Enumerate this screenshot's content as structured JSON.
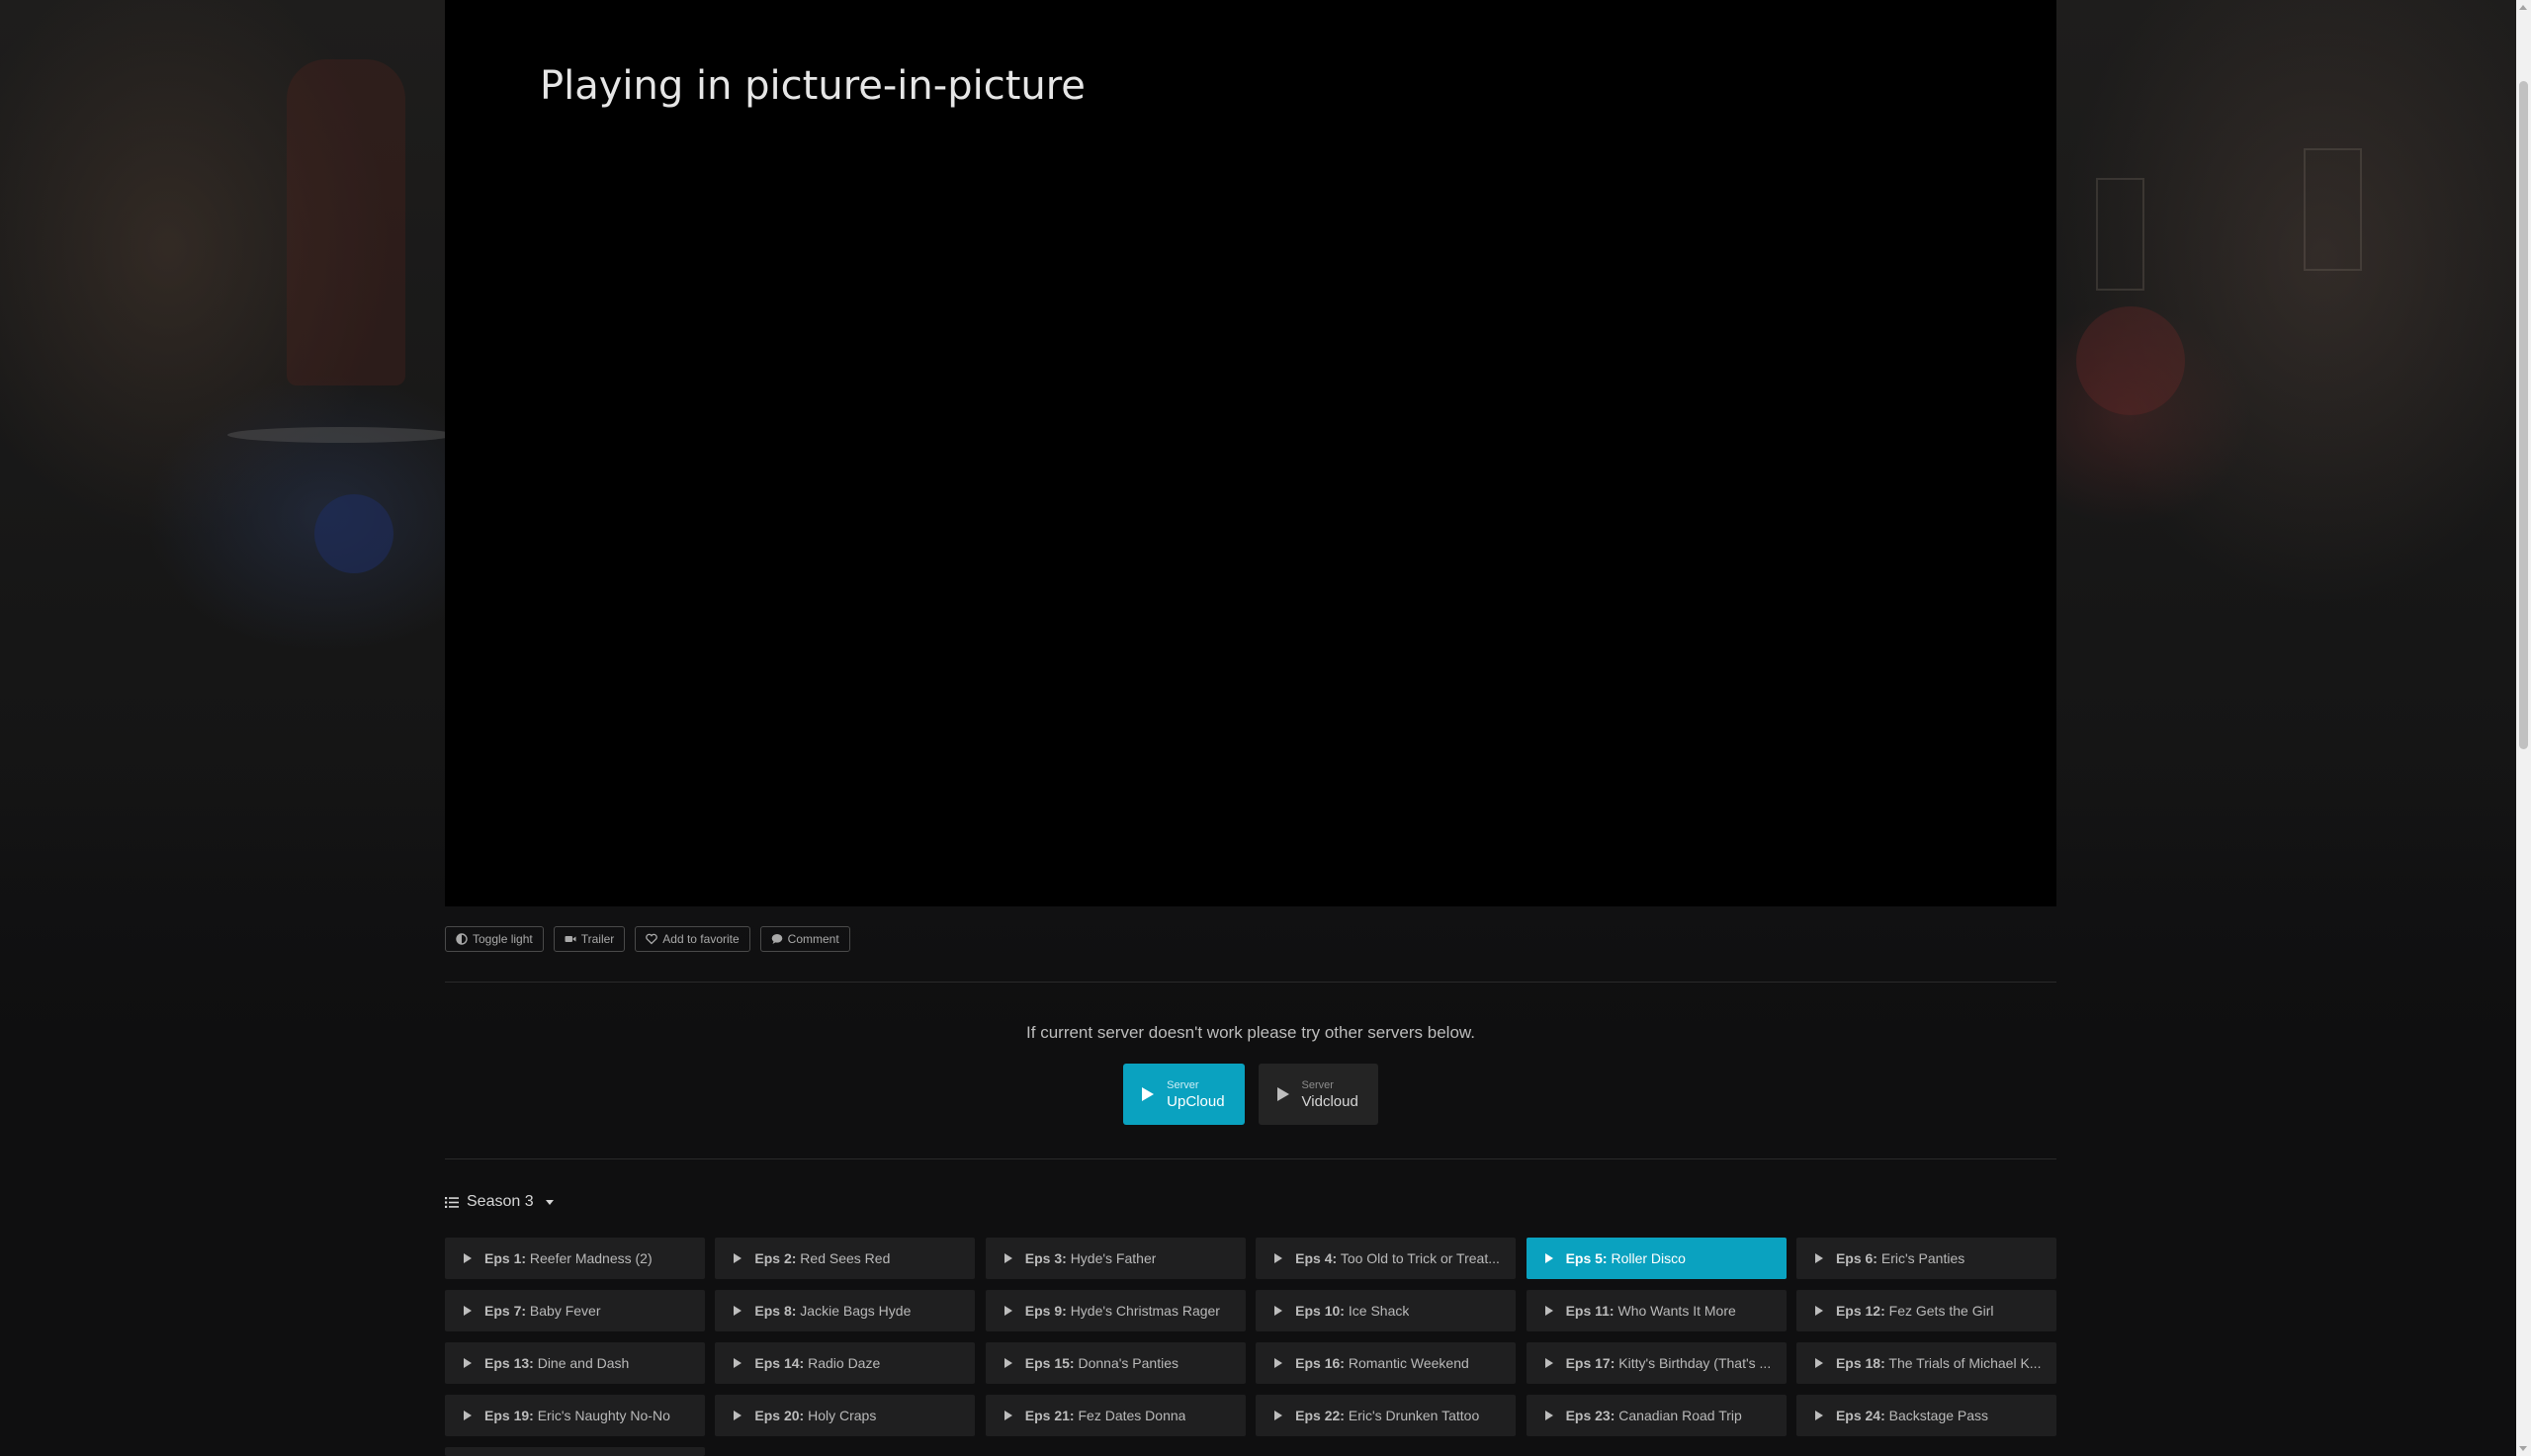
{
  "player": {
    "pip_message": "Playing in picture-in-picture"
  },
  "toolbar": {
    "toggle_light": "Toggle light",
    "trailer": "Trailer",
    "add_favorite": "Add to favorite",
    "comment": "Comment"
  },
  "servers": {
    "note": "If current server doesn't work please try other servers below.",
    "items": [
      {
        "small": "Server",
        "name": "UpCloud",
        "active": true
      },
      {
        "small": "Server",
        "name": "Vidcloud",
        "active": false
      }
    ]
  },
  "season": {
    "label": "Season 3"
  },
  "episodes": [
    {
      "num": "Eps 1:",
      "title": "Reefer Madness (2)"
    },
    {
      "num": "Eps 2:",
      "title": "Red Sees Red"
    },
    {
      "num": "Eps 3:",
      "title": "Hyde's Father"
    },
    {
      "num": "Eps 4:",
      "title": "Too Old to Trick or Treat..."
    },
    {
      "num": "Eps 5:",
      "title": "Roller Disco",
      "active": true
    },
    {
      "num": "Eps 6:",
      "title": "Eric's Panties"
    },
    {
      "num": "Eps 7:",
      "title": "Baby Fever"
    },
    {
      "num": "Eps 8:",
      "title": "Jackie Bags Hyde"
    },
    {
      "num": "Eps 9:",
      "title": "Hyde's Christmas Rager"
    },
    {
      "num": "Eps 10:",
      "title": "Ice Shack"
    },
    {
      "num": "Eps 11:",
      "title": "Who Wants It More"
    },
    {
      "num": "Eps 12:",
      "title": "Fez Gets the Girl"
    },
    {
      "num": "Eps 13:",
      "title": "Dine and Dash"
    },
    {
      "num": "Eps 14:",
      "title": "Radio Daze"
    },
    {
      "num": "Eps 15:",
      "title": "Donna's Panties"
    },
    {
      "num": "Eps 16:",
      "title": "Romantic Weekend"
    },
    {
      "num": "Eps 17:",
      "title": "Kitty's Birthday (That's ..."
    },
    {
      "num": "Eps 18:",
      "title": "The Trials of Michael K..."
    },
    {
      "num": "Eps 19:",
      "title": "Eric's Naughty No-No"
    },
    {
      "num": "Eps 20:",
      "title": "Holy Craps"
    },
    {
      "num": "Eps 21:",
      "title": "Fez Dates Donna"
    },
    {
      "num": "Eps 22:",
      "title": "Eric's Drunken Tattoo"
    },
    {
      "num": "Eps 23:",
      "title": "Canadian Road Trip"
    },
    {
      "num": "Eps 24:",
      "title": "Backstage Pass"
    }
  ],
  "colors": {
    "accent": "#0aa2c0",
    "page_bg": "#0f0f10",
    "button_bg": "#1f1f20"
  }
}
